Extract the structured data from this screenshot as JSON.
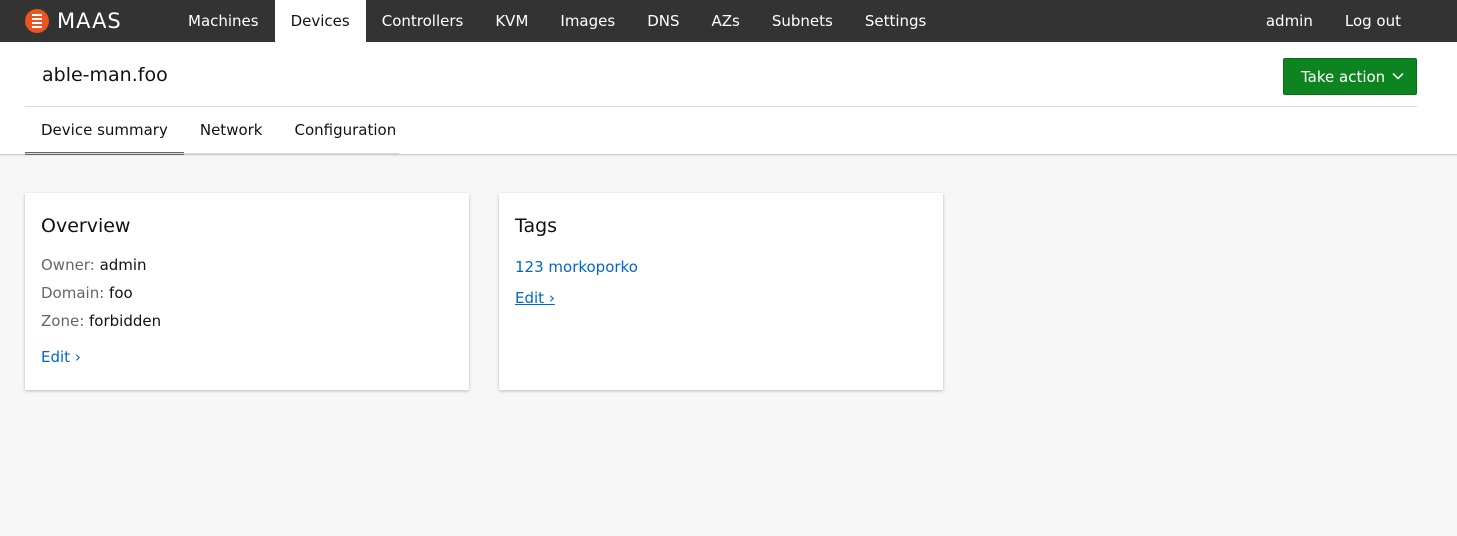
{
  "brand": {
    "name": "MAAS",
    "logo_icon": "maas-logo-icon",
    "logo_color": "#e95420"
  },
  "nav": {
    "items": [
      {
        "label": "Machines",
        "active": false
      },
      {
        "label": "Devices",
        "active": true
      },
      {
        "label": "Controllers",
        "active": false
      },
      {
        "label": "KVM",
        "active": false
      },
      {
        "label": "Images",
        "active": false
      },
      {
        "label": "DNS",
        "active": false
      },
      {
        "label": "AZs",
        "active": false
      },
      {
        "label": "Subnets",
        "active": false
      },
      {
        "label": "Settings",
        "active": false
      }
    ],
    "user": "admin",
    "logout": "Log out",
    "background": "#333333"
  },
  "header": {
    "title": "able-man.foo",
    "action_button": {
      "label": "Take action",
      "icon": "chevron-down-icon",
      "color": "#0e8420"
    },
    "tabs": [
      {
        "label": "Device summary",
        "active": true
      },
      {
        "label": "Network",
        "active": false
      },
      {
        "label": "Configuration",
        "active": false
      }
    ]
  },
  "overview": {
    "title": "Overview",
    "fields": [
      {
        "key": "Owner:",
        "value": "admin"
      },
      {
        "key": "Domain:",
        "value": "foo"
      },
      {
        "key": "Zone:",
        "value": "forbidden"
      }
    ],
    "edit": "Edit ›"
  },
  "tags": {
    "title": "Tags",
    "list": "123 morkoporko",
    "edit": "Edit ›"
  }
}
